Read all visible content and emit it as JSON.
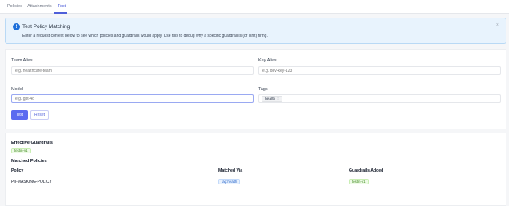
{
  "tabs": [
    {
      "label": "Policies"
    },
    {
      "label": "Attachments"
    },
    {
      "label": "Test"
    }
  ],
  "banner": {
    "icon": "info-icon",
    "icon_glyph": "!",
    "title": "Test Policy Matching",
    "description": "Enter a request context below to see which policies and guardrails would apply. Use this to debug why a specific guardrail is (or isn't) firing.",
    "close_glyph": "×"
  },
  "form": {
    "team_alias": {
      "label": "Team Alias",
      "placeholder": "e.g. healthcare-team"
    },
    "key_alias": {
      "label": "Key Alias",
      "placeholder": "e.g. dev-key-123"
    },
    "model": {
      "label": "Model",
      "placeholder": "e.g. gpt-4o"
    },
    "tags": {
      "label": "Tags",
      "values": [
        "health"
      ],
      "remove_glyph": "×"
    },
    "test_label": "Test",
    "reset_label": "Reset"
  },
  "results": {
    "effective_title": "Effective Guardrails",
    "effective_guardrails": [
      "testin-v1"
    ],
    "matched_title": "Matched Policies",
    "columns": [
      "Policy",
      "Matched Via",
      "Guardrails Added"
    ],
    "rows": [
      {
        "policy": "PII-MASKING-POLICY",
        "matched_via": "tag:health",
        "guardrails_added": "testin-v1"
      }
    ]
  },
  "colors": {
    "accent": "#5b6bf0",
    "banner_bg": "#e8f3fd",
    "badge_green": "#3f8a1f",
    "badge_blue": "#2563c9"
  }
}
